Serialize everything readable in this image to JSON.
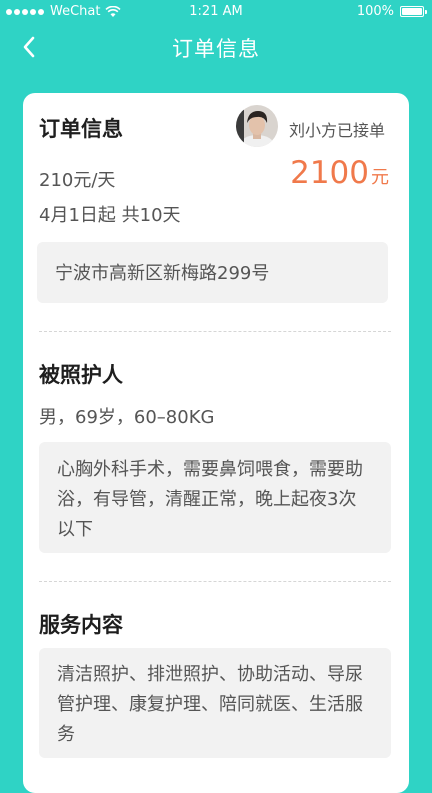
{
  "status_bar": {
    "carrier": "WeChat",
    "time": "1:21 AM",
    "battery": "100%",
    "battery_level": 1.0
  },
  "nav": {
    "title": "订单信息",
    "back_icon": "chevron-left-icon"
  },
  "order": {
    "section_title": "订单信息",
    "caregiver_status": "刘小方已接单",
    "price_per_day": "210元/天",
    "total_amount": "2100",
    "total_unit": "元",
    "date_range": "4月1日起 共10天",
    "address": "宁波市高新区新梅路299号"
  },
  "patient": {
    "section_title": "被照护人",
    "info": "男，69岁，60–80KG",
    "condition": "心胸外科手术，需要鼻饲喂食，需要助浴，有导管，清醒正常，晚上起夜3次以下"
  },
  "services": {
    "section_title": "服务内容",
    "content": "清洁照护、排泄照护、协助活动、导尿管护理、康复护理、陪同就医、生活服务"
  },
  "colors": {
    "background": "#2fd3c5",
    "price_accent": "#f0794b",
    "card": "#ffffff",
    "box": "#f2f2f2"
  }
}
